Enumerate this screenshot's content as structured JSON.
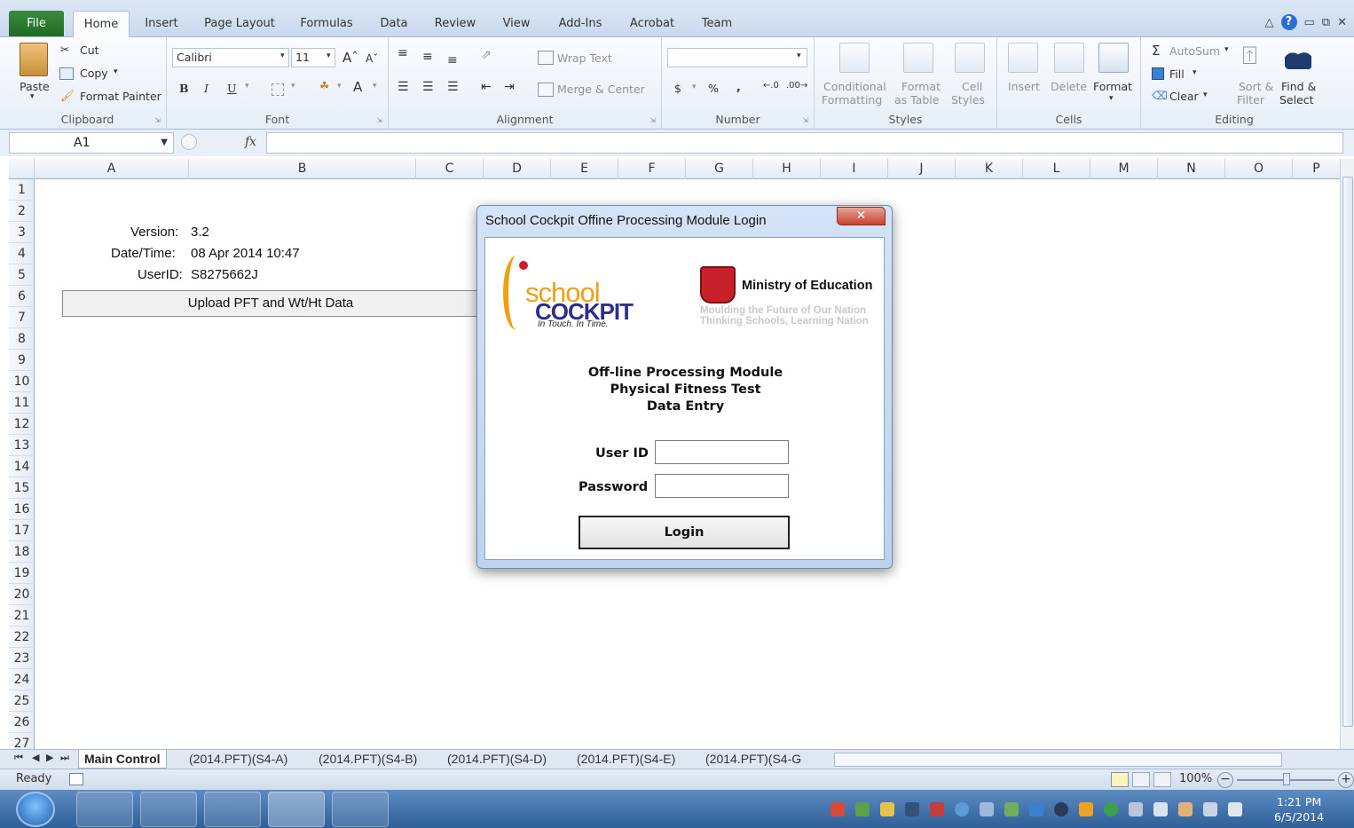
{
  "ribbon": {
    "file_tab": "File",
    "tabs": [
      "Home",
      "Insert",
      "Page Layout",
      "Formulas",
      "Data",
      "Review",
      "View",
      "Add-Ins",
      "Acrobat",
      "Team"
    ],
    "clipboard": {
      "paste": "Paste",
      "cut": "Cut",
      "copy": "Copy",
      "format_painter": "Format Painter",
      "label": "Clipboard"
    },
    "font": {
      "name": "Calibri",
      "size": "11",
      "bold": "B",
      "italic": "I",
      "underline": "U",
      "label": "Font"
    },
    "alignment": {
      "wrap_text": "Wrap Text",
      "merge_center": "Merge & Center",
      "label": "Alignment"
    },
    "number": {
      "currency": "$",
      "percent": "%",
      "comma": ",",
      "label": "Number"
    },
    "styles": {
      "conditional": [
        "Conditional",
        "Formatting"
      ],
      "format_table": [
        "Format",
        "as Table"
      ],
      "cell_styles": [
        "Cell",
        "Styles"
      ],
      "label": "Styles"
    },
    "cells": {
      "insert": "Insert",
      "delete": "Delete",
      "format": "Format",
      "label": "Cells"
    },
    "editing": {
      "autosum": "AutoSum",
      "fill": "Fill",
      "clear": "Clear",
      "sort_filter": [
        "Sort &",
        "Filter"
      ],
      "find_select": [
        "Find &",
        "Select"
      ],
      "label": "Editing"
    }
  },
  "formula_bar": {
    "name_box": "A1",
    "fx": "fx",
    "value": ""
  },
  "grid": {
    "columns": [
      "A",
      "B",
      "C",
      "D",
      "E",
      "F",
      "G",
      "H",
      "I",
      "J",
      "K",
      "L",
      "M",
      "N",
      "O",
      "P"
    ],
    "rows": [
      "1",
      "2",
      "3",
      "4",
      "5",
      "6",
      "7",
      "8",
      "9",
      "10",
      "11",
      "12",
      "13",
      "14",
      "15",
      "16",
      "17",
      "18",
      "19",
      "20",
      "21",
      "22",
      "23",
      "24",
      "25",
      "26",
      "27"
    ],
    "version_label": "Version:",
    "version_value": "3.2",
    "datetime_label": "Date/Time:",
    "datetime_value": "08 Apr 2014 10:47",
    "userid_label": "UserID:",
    "userid_value": "S8275662J",
    "upload_button": "Upload PFT and Wt/Ht Data"
  },
  "sheets": [
    "Main Control",
    "(2014.PFT)(S4-A)",
    "(2014.PFT)(S4-B)",
    "(2014.PFT)(S4-D)",
    "(2014.PFT)(S4-E)",
    "(2014.PFT)(S4-G"
  ],
  "status": {
    "ready": "Ready",
    "zoom": "100%"
  },
  "taskbar": {
    "time": "1:21 PM",
    "date": "6/5/2014"
  },
  "dialog": {
    "title": "School Cockpit Offine Processing Module Login",
    "close": "✕",
    "logo_school": "school",
    "logo_cockpit": "COCKPIT",
    "logo_tagline": "In Touch. In Time.",
    "moe_title": "Ministry of Education",
    "moe_line1": "Moulding the Future of Our Nation",
    "moe_line2": "Thinking Schools, Learning Nation",
    "heading1": "Off-line Processing Module",
    "heading2": "Physical Fitness Test",
    "heading3": "Data Entry",
    "userid_label": "User ID",
    "password_label": "Password",
    "userid_value": "",
    "password_value": "",
    "login_button": "Login"
  }
}
